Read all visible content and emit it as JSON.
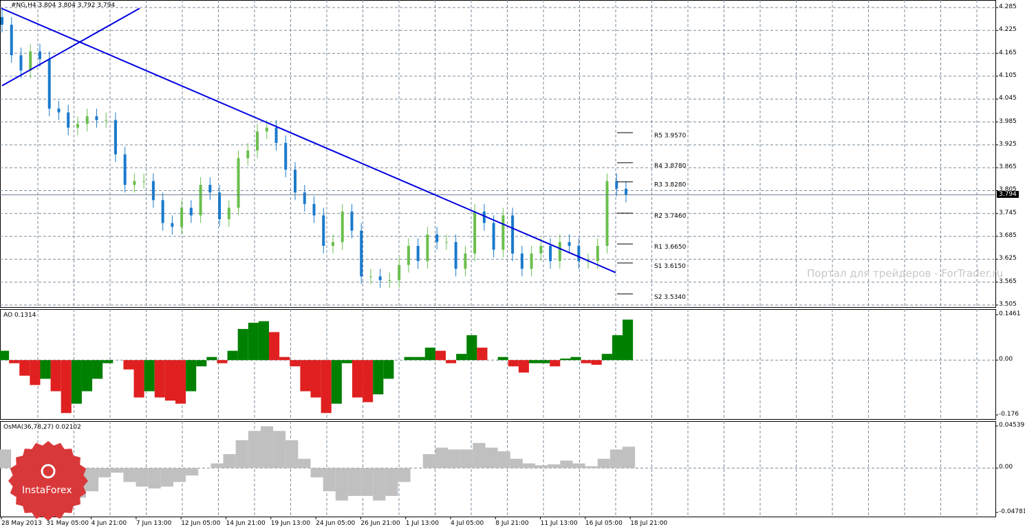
{
  "title": "#NG,H4  3.804 3.804 3.792 3.794",
  "watermark": "Портал для трейдеров - ForTrader.ru",
  "logo": "InstaForex",
  "colors": {
    "bull": "#6bbf4e",
    "bear": "#1a7acc",
    "trend": "#0000e0",
    "ao_up": "#008000",
    "ao_down": "#e02020",
    "osma": "#c0c0c0",
    "grid": "#7a8a9a"
  },
  "chart_data": [
    {
      "type": "candlestick",
      "symbol": "#NG",
      "timeframe": "H4",
      "ylim": [
        3.505,
        4.285
      ],
      "yticks": [
        "4.285",
        "4.225",
        "4.165",
        "4.105",
        "4.045",
        "3.985",
        "3.925",
        "3.865",
        "3.805",
        "3.745",
        "3.685",
        "3.625",
        "3.565",
        "3.505"
      ],
      "current_price": "3.794",
      "closes": [
        4.24,
        4.16,
        4.12,
        4.17,
        4.15,
        4.02,
        4.01,
        3.97,
        3.98,
        4.0,
        3.99,
        3.99,
        3.9,
        3.82,
        3.83,
        3.83,
        3.78,
        3.72,
        3.71,
        3.76,
        3.74,
        3.82,
        3.8,
        3.73,
        3.76,
        3.89,
        3.91,
        3.96,
        3.97,
        3.93,
        3.86,
        3.8,
        3.77,
        3.74,
        3.66,
        3.67,
        3.75,
        3.7,
        3.58,
        3.58,
        3.57,
        3.57,
        3.61,
        3.66,
        3.62,
        3.69,
        3.67,
        3.67,
        3.6,
        3.64,
        3.75,
        3.72,
        3.65,
        3.74,
        3.64,
        3.6,
        3.64,
        3.66,
        3.62,
        3.67,
        3.66,
        3.62,
        3.62,
        3.66,
        3.83,
        3.81,
        3.794
      ],
      "trendlines": [
        {
          "from": 4.283,
          "to": 3.59
        },
        {
          "from": 4.08,
          "to": 4.283
        }
      ],
      "pivots": [
        {
          "label": "R5 3.9570",
          "value": 3.957
        },
        {
          "label": "R4 3.8780",
          "value": 3.878
        },
        {
          "label": "R3 3.8280",
          "value": 3.828
        },
        {
          "label": "R2 3.7460",
          "value": 3.746
        },
        {
          "label": "R1 3.6650",
          "value": 3.665
        },
        {
          "label": "S1 3.6150",
          "value": 3.615
        },
        {
          "label": "S2 3.5340",
          "value": 3.534
        }
      ],
      "xticks": [
        "28 May 2013",
        "31 May 05:00",
        "4 Jun 21:00",
        "7 Jun 13:00",
        "12 Jun 05:00",
        "14 Jun 21:00",
        "19 Jun 13:00",
        "24 Jun 05:00",
        "26 Jun 21:00",
        "1 Jul 13:00",
        "4 Jul 05:00",
        "8 Jul 21:00",
        "11 Jul 13:00",
        "16 Jul 05:00",
        "18 Jul 21:00"
      ]
    },
    {
      "type": "bar",
      "name": "AO 0.1314",
      "ylim": [
        -0.176,
        0.1461
      ],
      "yticks": [
        "0.1461",
        "0.00",
        "-0.176"
      ],
      "values": [
        0.03,
        -0.01,
        -0.05,
        -0.08,
        -0.06,
        -0.1,
        -0.17,
        -0.14,
        -0.1,
        -0.06,
        -0.01,
        0,
        -0.03,
        -0.12,
        -0.1,
        -0.12,
        -0.13,
        -0.14,
        -0.1,
        -0.02,
        0.01,
        -0.01,
        0.03,
        0.1,
        0.12,
        0.125,
        0.09,
        0.01,
        -0.02,
        -0.1,
        -0.12,
        -0.17,
        -0.14,
        -0.01,
        -0.12,
        -0.135,
        -0.11,
        -0.06,
        0,
        0.01,
        0.01,
        0.04,
        0.03,
        -0.01,
        0.02,
        0.08,
        0.04,
        0,
        0.01,
        -0.02,
        -0.04,
        -0.01,
        -0.01,
        -0.02,
        0.005,
        0.01,
        -0.01,
        -0.015,
        0.02,
        0.08,
        0.13
      ]
    },
    {
      "type": "bar",
      "name": "OsMA(36,78,27) 0.02102",
      "ylim": [
        -0.04781,
        0.04539
      ],
      "yticks": [
        "0.04539",
        "0.00",
        "-0.04781"
      ],
      "values": [
        0.02,
        0,
        -0.005,
        -0.015,
        -0.025,
        -0.03,
        -0.032,
        -0.025,
        -0.01,
        -0.005,
        -0.015,
        -0.02,
        -0.022,
        -0.02,
        -0.015,
        -0.008,
        0,
        0.005,
        0.015,
        0.03,
        0.04,
        0.045,
        0.04,
        0.03,
        0.01,
        -0.01,
        -0.025,
        -0.035,
        -0.03,
        -0.03,
        -0.035,
        -0.03,
        -0.015,
        0,
        0.015,
        0.022,
        0.02,
        0.02,
        0.027,
        0.022,
        0.018,
        0.01,
        0.005,
        0.003,
        0.004,
        0.008,
        0.005,
        0.002,
        0.01,
        0.02,
        0.023
      ]
    }
  ]
}
